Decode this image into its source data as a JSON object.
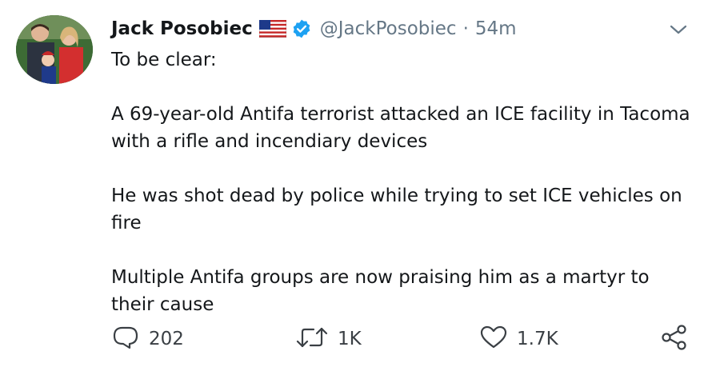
{
  "author": {
    "display_name": "Jack Posobiec",
    "handle": "@JackPosobiec",
    "time": "54m"
  },
  "icons": {
    "flag": "us-flag-icon",
    "verified": "verified-badge-icon",
    "caret": "chevron-down-icon",
    "reply": "reply-icon",
    "retweet": "retweet-icon",
    "like": "heart-icon",
    "share": "share-icon"
  },
  "tweet": {
    "paragraphs": [
      "To be clear:",
      "A 69-year-old Antifa terrorist attacked an ICE facility in Tacoma with a rifle and incendiary devices",
      "He was shot dead by police while trying to set ICE vehicles on fire",
      "Multiple Antifa groups are now praising him as a martyr to their cause"
    ]
  },
  "actions": {
    "reply_count": "202",
    "retweet_count": "1K",
    "like_count": "1.7K"
  },
  "colors": {
    "text": "#14171a",
    "secondary": "#657786",
    "verified": "#1da1f2"
  }
}
